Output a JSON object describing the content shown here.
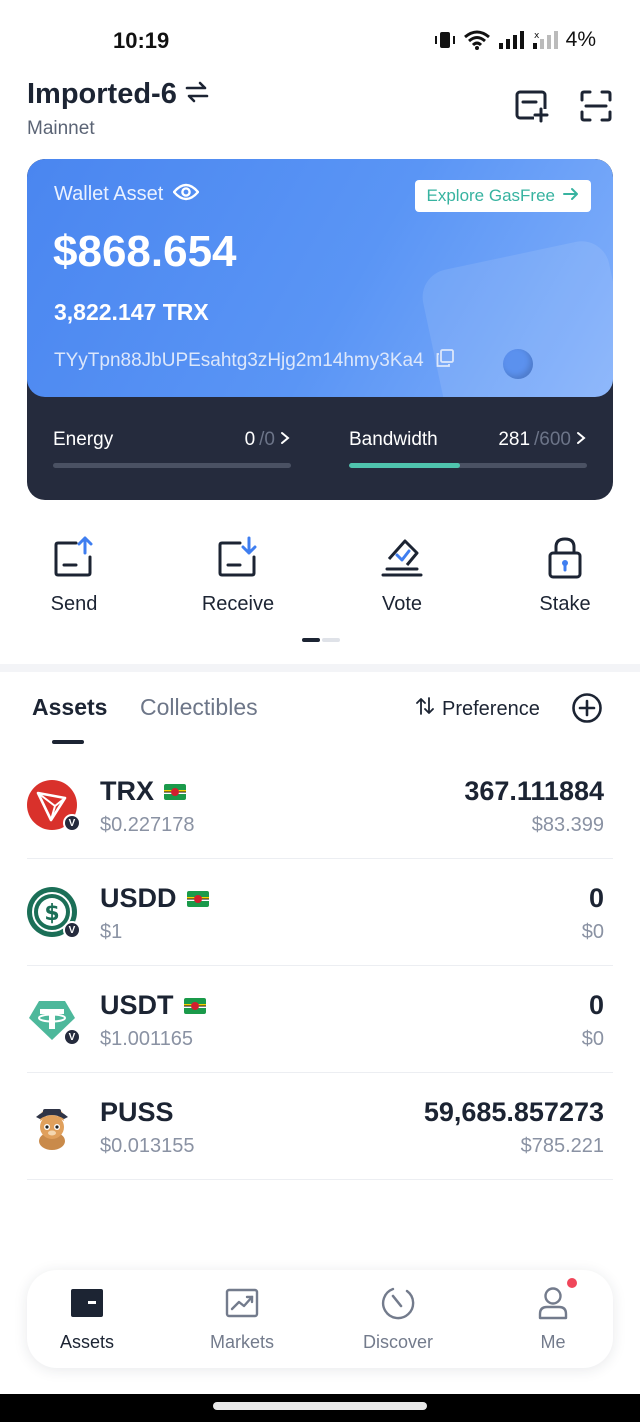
{
  "status_bar": {
    "time": "10:19",
    "battery": "4%"
  },
  "header": {
    "wallet_name": "Imported-6",
    "network": "Mainnet"
  },
  "wallet_card": {
    "title": "Wallet Asset",
    "explore_label": "Explore GasFree",
    "usd_balance": "$868.654",
    "trx_balance": "3,822.147 TRX",
    "address": "TYyTpn88JbUPEsahtg3zHjg2m14hmy3Ka4",
    "energy": {
      "label": "Energy",
      "used": "0",
      "total": "/0",
      "level": 0.0
    },
    "bandwidth": {
      "label": "Bandwidth",
      "used": "281",
      "total": "/600",
      "level": 0.468
    }
  },
  "actions": [
    {
      "label": "Send",
      "icon": "send-icon"
    },
    {
      "label": "Receive",
      "icon": "receive-icon"
    },
    {
      "label": "Vote",
      "icon": "vote-icon"
    },
    {
      "label": "Stake",
      "icon": "stake-lock-icon"
    }
  ],
  "tabs": {
    "assets": "Assets",
    "collectibles": "Collectibles",
    "preference": "Preference"
  },
  "tokens": [
    {
      "symbol": "TRX",
      "price": "$0.227178",
      "amount": "367.111884",
      "value": "$83.399",
      "verified": "V",
      "logo": "tron-logo"
    },
    {
      "symbol": "USDD",
      "price": "$1",
      "amount": "0",
      "value": "$0",
      "verified": "V",
      "logo": "usdd-logo"
    },
    {
      "symbol": "USDT",
      "price": "$1.001165",
      "amount": "0",
      "value": "$0",
      "verified": "V",
      "logo": "tether-logo"
    },
    {
      "symbol": "PUSS",
      "price": "$0.013155",
      "amount": "59,685.857273",
      "value": "$785.221",
      "logo": "puss-cat-logo"
    }
  ],
  "bottom_nav": [
    {
      "label": "Assets",
      "icon": "wallet-icon",
      "active": true
    },
    {
      "label": "Markets",
      "icon": "chart-icon"
    },
    {
      "label": "Discover",
      "icon": "discover-icon"
    },
    {
      "label": "Me",
      "icon": "user-icon"
    }
  ],
  "colors": {
    "card_blue": "#4a86f0",
    "card_dark": "#252b3d",
    "accent_teal": "#4fc4ae",
    "text_dark": "#1c2433",
    "notification_red": "#f0465a"
  }
}
